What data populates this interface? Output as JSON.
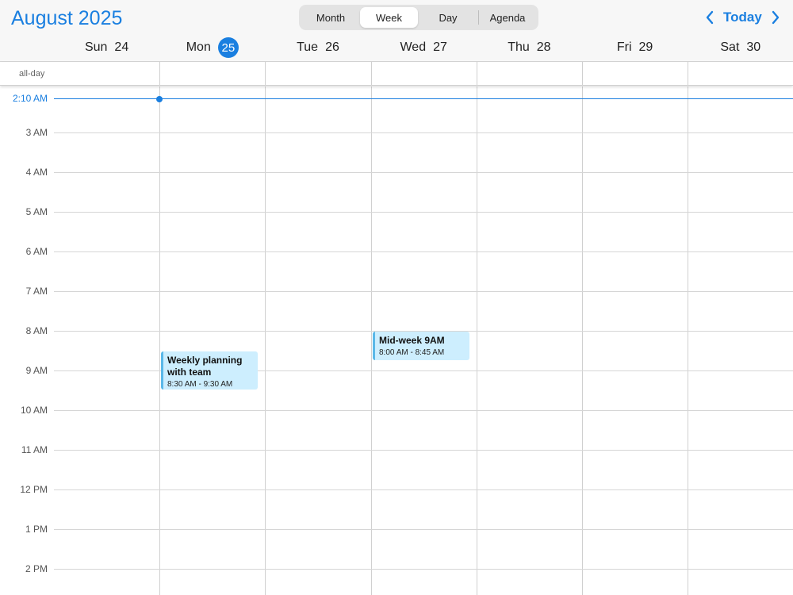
{
  "header": {
    "month_title": "August 2025",
    "views": [
      "Month",
      "Week",
      "Day",
      "Agenda"
    ],
    "active_view": "Week",
    "today_label": "Today"
  },
  "days": [
    {
      "name": "Sun",
      "num": "24"
    },
    {
      "name": "Mon",
      "num": "25",
      "today": true
    },
    {
      "name": "Tue",
      "num": "26"
    },
    {
      "name": "Wed",
      "num": "27"
    },
    {
      "name": "Thu",
      "num": "28"
    },
    {
      "name": "Fri",
      "num": "29"
    },
    {
      "name": "Sat",
      "num": "30"
    }
  ],
  "allday_label": "all-day",
  "now": {
    "label": "2:10 AM",
    "hour": 2.1667,
    "day_index": 1
  },
  "hours": [
    "3 AM",
    "4 AM",
    "5 AM",
    "6 AM",
    "7 AM",
    "8 AM",
    "9 AM",
    "10 AM",
    "11 AM",
    "12 PM",
    "1 PM",
    "2 PM"
  ],
  "events": [
    {
      "title": "Weekly planning with team",
      "time": "8:30 AM - 9:30 AM",
      "day_index": 1,
      "start": 8.5,
      "end": 9.5
    },
    {
      "title": "Mid-week 9AM",
      "time": "8:00 AM - 8:45 AM",
      "day_index": 3,
      "start": 8.0,
      "end": 8.75
    }
  ],
  "colors": {
    "accent": "#1a7fe0",
    "event_bg": "#cdeefe",
    "event_border": "#5ab8e8"
  }
}
